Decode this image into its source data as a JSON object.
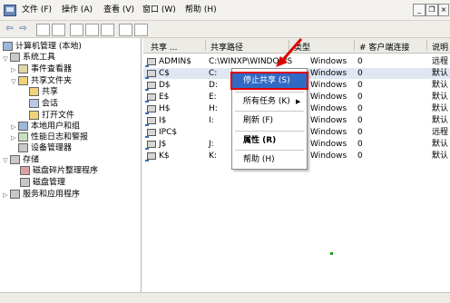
{
  "menu": {
    "file": "文件 (F)",
    "action": "操作 (A)",
    "view": "查看 (V)",
    "window": "窗口 (W)",
    "help": "帮助 (H)"
  },
  "toolbar": {
    "back": "⇦",
    "forward": "⇨"
  },
  "tree": {
    "root": "计算机管理 (本地)",
    "system_tools": "系统工具",
    "event_viewer": "事件查看器",
    "shared_folders": "共享文件夹",
    "shares": "共享",
    "sessions": "会话",
    "open_files": "打开文件",
    "local_users": "本地用户和组",
    "perf_logs": "性能日志和警报",
    "device_manager": "设备管理器",
    "storage": "存储",
    "defrag": "磁盘碎片整理程序",
    "disk_mgmt": "磁盘管理",
    "services": "服务和应用程序"
  },
  "columns": {
    "share": "共享 ...",
    "path": "共享路径",
    "type": "类型",
    "clients": "# 客户端连接",
    "desc": "说明"
  },
  "rows": [
    {
      "share": "ADMIN$",
      "path": "C:\\WINXP\\WINDOWS",
      "type": "Windows",
      "clients": "0",
      "desc": "远程"
    },
    {
      "share": "C$",
      "path": "C:",
      "type": "Windows",
      "clients": "0",
      "desc": "默认"
    },
    {
      "share": "D$",
      "path": "D:",
      "type": "Windows",
      "clients": "0",
      "desc": "默认"
    },
    {
      "share": "E$",
      "path": "E:",
      "type": "Windows",
      "clients": "0",
      "desc": "默认"
    },
    {
      "share": "H$",
      "path": "H:",
      "type": "Windows",
      "clients": "0",
      "desc": "默认"
    },
    {
      "share": "I$",
      "path": "I:",
      "type": "Windows",
      "clients": "0",
      "desc": "默认"
    },
    {
      "share": "IPC$",
      "path": "",
      "type": "Windows",
      "clients": "0",
      "desc": "远程"
    },
    {
      "share": "J$",
      "path": "J:",
      "type": "Windows",
      "clients": "0",
      "desc": "默认"
    },
    {
      "share": "K$",
      "path": "K:",
      "type": "Windows",
      "clients": "0",
      "desc": "默认"
    }
  ],
  "context_menu": {
    "stop_sharing": "停止共享 (S)",
    "all_tasks": "所有任务 (K)",
    "refresh": "刷新 (F)",
    "properties": "属性 (R)",
    "help": "帮助 (H)",
    "submenu_arrow": "▶"
  },
  "colors": {
    "highlight": "#316ac5",
    "annotation_red": "#e00000"
  }
}
